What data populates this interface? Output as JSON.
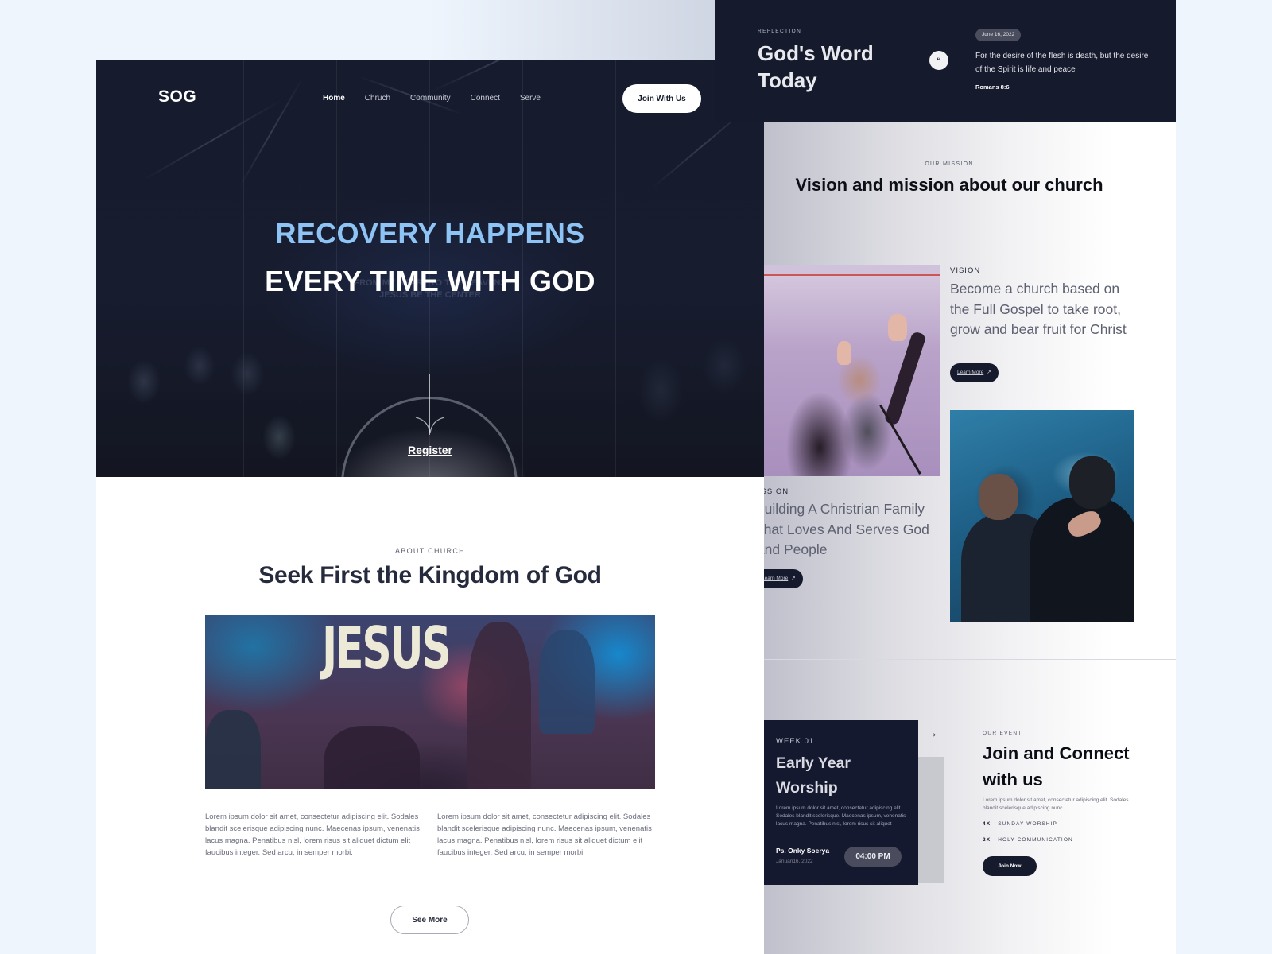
{
  "nav": {
    "logo": "SOG",
    "links": [
      "Home",
      "Chruch",
      "Community",
      "Connect",
      "Serve"
    ],
    "active": "Home",
    "cta": "Join With Us"
  },
  "hero": {
    "title_line1": "RECOVERY HAPPENS",
    "title_line2": "EVERY TIME WITH GOD",
    "background_text_1": "FROM MY HEART TO THE HEAVENS",
    "background_text_2": "JESUS BE THE CENTER",
    "register_label": "Register",
    "accent_color": "#8ec4f5"
  },
  "about": {
    "eyebrow": "ABOUT CHURCH",
    "title": "Seek First the Kingdom of God",
    "image_text": "JESUS",
    "paragraph_left": "Lorem ipsum dolor sit amet, consectetur adipiscing elit. Sodales blandit scelerisque adipiscing nunc. Maecenas ipsum, venenatis lacus magna. Penatibus nisl, lorem risus sit aliquet dictum elit faucibus integer. Sed arcu, in semper morbi.",
    "paragraph_right": "Lorem ipsum dolor sit amet, consectetur adipiscing elit. Sodales blandit scelerisque adipiscing nunc. Maecenas ipsum, venenatis lacus magna. Penatibus nisl, lorem risus sit aliquet dictum elit faucibus integer. Sed arcu, in semper morbi.",
    "see_more_label": "See More"
  },
  "reflection": {
    "eyebrow": "REFLECTION",
    "title": "God's Word Today",
    "quote_icon": "“",
    "date": "June 16, 2022",
    "verse": "For the desire of the flesh is death, but the desire of the Spirit is life and peace",
    "reference": "Romans 8:6"
  },
  "mission": {
    "eyebrow": "OUR MISSION",
    "title": "Vision and mission about our church",
    "vision_label": "VISION",
    "vision_text": "Become a church based on the Full Gospel to take root, grow and bear fruit for Christ",
    "vision_button": "Learn More",
    "mission_label": "MISSION",
    "mission_text": "Building A Christrian Family  That Loves And Serves God And People",
    "mission_button": "Learn More",
    "button_arrow": "↗"
  },
  "event": {
    "week": "WEEK 01",
    "title": "Early Year Worship",
    "description": "Lorem ipsum dolor sit amet, consectetur adipiscing elit. Sodales blandit scelerisque. Maecenas ipsum, venenatis lacus magna. Penatibus nisl, lorem risus sit aliquet",
    "pastor": "Ps. Onky Soerya",
    "date": "Januari16, 2022",
    "time": "04:00  PM",
    "next_arrow": "→"
  },
  "join_section": {
    "eyebrow": "OUR EVENT",
    "title": "Join and Connect with us",
    "description": "Lorem ipsum dolor sit amet, consectetur adipiscing elit. Sodales blandit scelerisque adipiscing nunc.",
    "stats": [
      {
        "count": "4X",
        "label": " - SUNDAY WORSHIP"
      },
      {
        "count": "2X",
        "label": " - HOLY COMMUNICATION"
      }
    ],
    "button": "Join Now"
  }
}
